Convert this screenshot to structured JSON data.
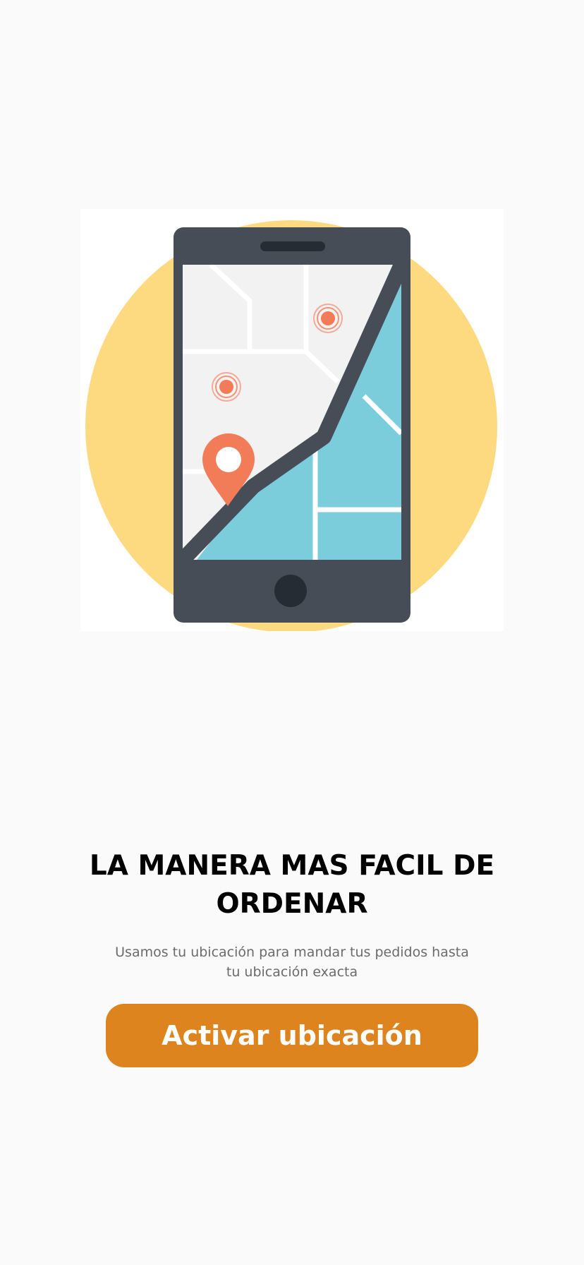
{
  "illustration": {
    "icon": "phone-map-location-icon",
    "colors": {
      "circle": "#fdda80",
      "phone_body": "#474d57",
      "map_land": "#f2f2f2",
      "map_water": "#7ccddc",
      "pin": "#f27c58",
      "home_button": "#252c33"
    }
  },
  "onboarding": {
    "title": "LA MANERA MAS FACIL DE ORDENAR",
    "subtitle": "Usamos tu ubicación para mandar tus pedidos hasta tu ubicación exacta",
    "cta_label": "Activar ubicación"
  },
  "colors": {
    "background": "#fafafa",
    "accent": "#dd841e",
    "title": "#000000",
    "subtitle": "#6b6b6b"
  }
}
